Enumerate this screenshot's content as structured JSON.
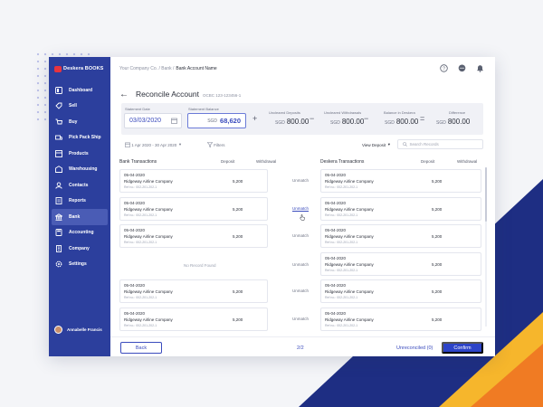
{
  "app": {
    "logo_text": "Deskera",
    "logo_bold": "BOOKS"
  },
  "sidebar": {
    "items": [
      {
        "label": "Dashboard",
        "icon": "dashboard-icon"
      },
      {
        "label": "Sell",
        "icon": "sell-icon"
      },
      {
        "label": "Buy",
        "icon": "buy-icon"
      },
      {
        "label": "Pick Pack Ship",
        "icon": "pick-pack-ship-icon"
      },
      {
        "label": "Products",
        "icon": "products-icon"
      },
      {
        "label": "Warehousing",
        "icon": "warehouse-icon"
      },
      {
        "label": "Contacts",
        "icon": "contacts-icon"
      },
      {
        "label": "Reports",
        "icon": "reports-icon"
      },
      {
        "label": "Bank",
        "icon": "bank-icon",
        "active": true
      },
      {
        "label": "Accounting",
        "icon": "accounting-icon"
      },
      {
        "label": "Company",
        "icon": "company-icon"
      },
      {
        "label": "Settings",
        "icon": "settings-icon"
      }
    ],
    "user_name": "Annabelle Francis"
  },
  "breadcrumb": {
    "parent": "Your Company Co. / Bank /",
    "current": "Bank Account Name"
  },
  "page": {
    "title": "Reconcile Account",
    "account_code": "OCBC 123-123456-1"
  },
  "summary": {
    "statement_date_label": "Statement Date",
    "statement_date": "03/03/2020",
    "statement_balance_label": "Statement Balance",
    "statement_balance_currency": "SGD",
    "statement_balance": "68,620",
    "uncleared_deposits_label": "Uncleared Deposits",
    "uncleared_deposits": "800.00",
    "uncleared_withdrawals_label": "Uncleared Withdrawals",
    "uncleared_withdrawals": "800.00",
    "balance_in_deskera_label": "Balance in Deskera",
    "balance_in_deskera": "800.00",
    "difference_label": "Difference",
    "difference": "800.00",
    "currency": "SGD",
    "op_plus": "+",
    "op_minus": "−",
    "op_minus2": "−",
    "op_equals": "="
  },
  "filters": {
    "date_range": "1 Apr 2020 - 30 Apr 2020",
    "filters_label": "Filters",
    "view_label": "View Deposit",
    "search_placeholder": "Search Records"
  },
  "bank": {
    "heading": "Bank Transactions",
    "deposit_col": "Deposit",
    "withdrawal_col": "Withdrawal",
    "no_record": "No Record Found",
    "rows": [
      {
        "date": "05-04-2020",
        "company": "Ridgeway Airline Company",
        "ref": "Ref no.: 002-201-202-1",
        "deposit": "5,200"
      },
      {
        "date": "05-04-2020",
        "company": "Ridgeway Airline Company",
        "ref": "Ref no.: 002-201-202-1",
        "deposit": "5,200"
      },
      {
        "date": "05-04-2020",
        "company": "Ridgeway Airline Company",
        "ref": "Ref no.: 002-201-202-1",
        "deposit": "5,200"
      },
      {
        "date": "05-04-2020",
        "company": "Ridgeway Airline Company",
        "ref": "Ref no.: 002-201-202-1",
        "deposit": "5,200"
      },
      {
        "date": "05-04-2020",
        "company": "Ridgeway Airline Company",
        "ref": "Ref no.: 002-201-202-1",
        "deposit": "5,200"
      }
    ]
  },
  "unmatch_label": "Unmatch",
  "deskera": {
    "heading": "Deskera Transactions",
    "deposit_col": "Deposit",
    "withdrawal_col": "Withdrawal",
    "rows": [
      {
        "date": "05-04-2020",
        "company": "Ridgeway Airline Company",
        "ref": "Ref no.: 002-201-202-1",
        "deposit": "5,200"
      },
      {
        "date": "05-04-2020",
        "company": "Ridgeway Airline Company",
        "ref": "Ref no.: 002-201-202-1",
        "deposit": "5,200"
      },
      {
        "date": "05-04-2020",
        "company": "Ridgeway Airline Company",
        "ref": "Ref no.: 002-201-202-1",
        "deposit": "5,200"
      },
      {
        "date": "05-04-2020",
        "company": "Ridgeway Airline Company",
        "ref": "Ref no.: 002-201-202-1",
        "deposit": "5,200"
      },
      {
        "date": "05-04-2020",
        "company": "Ridgeway Airline Company",
        "ref": "Ref no.: 002-201-202-1",
        "deposit": "5,200"
      },
      {
        "date": "05-04-2020",
        "company": "Ridgeway Airline Company",
        "ref": "Ref no.: 002-201-202-1",
        "deposit": "5,200"
      }
    ]
  },
  "footer": {
    "back_label": "Back",
    "page_indicator": "2/2",
    "unreconciled_label": "Unreconciled (0)",
    "confirm_label": "Confirm"
  },
  "colors": {
    "sidebar": "#2c3f9d",
    "primary": "#2d44c8",
    "accent_yellow": "#f6b62c",
    "accent_orange": "#f07b23",
    "navy": "#1e2e83"
  }
}
